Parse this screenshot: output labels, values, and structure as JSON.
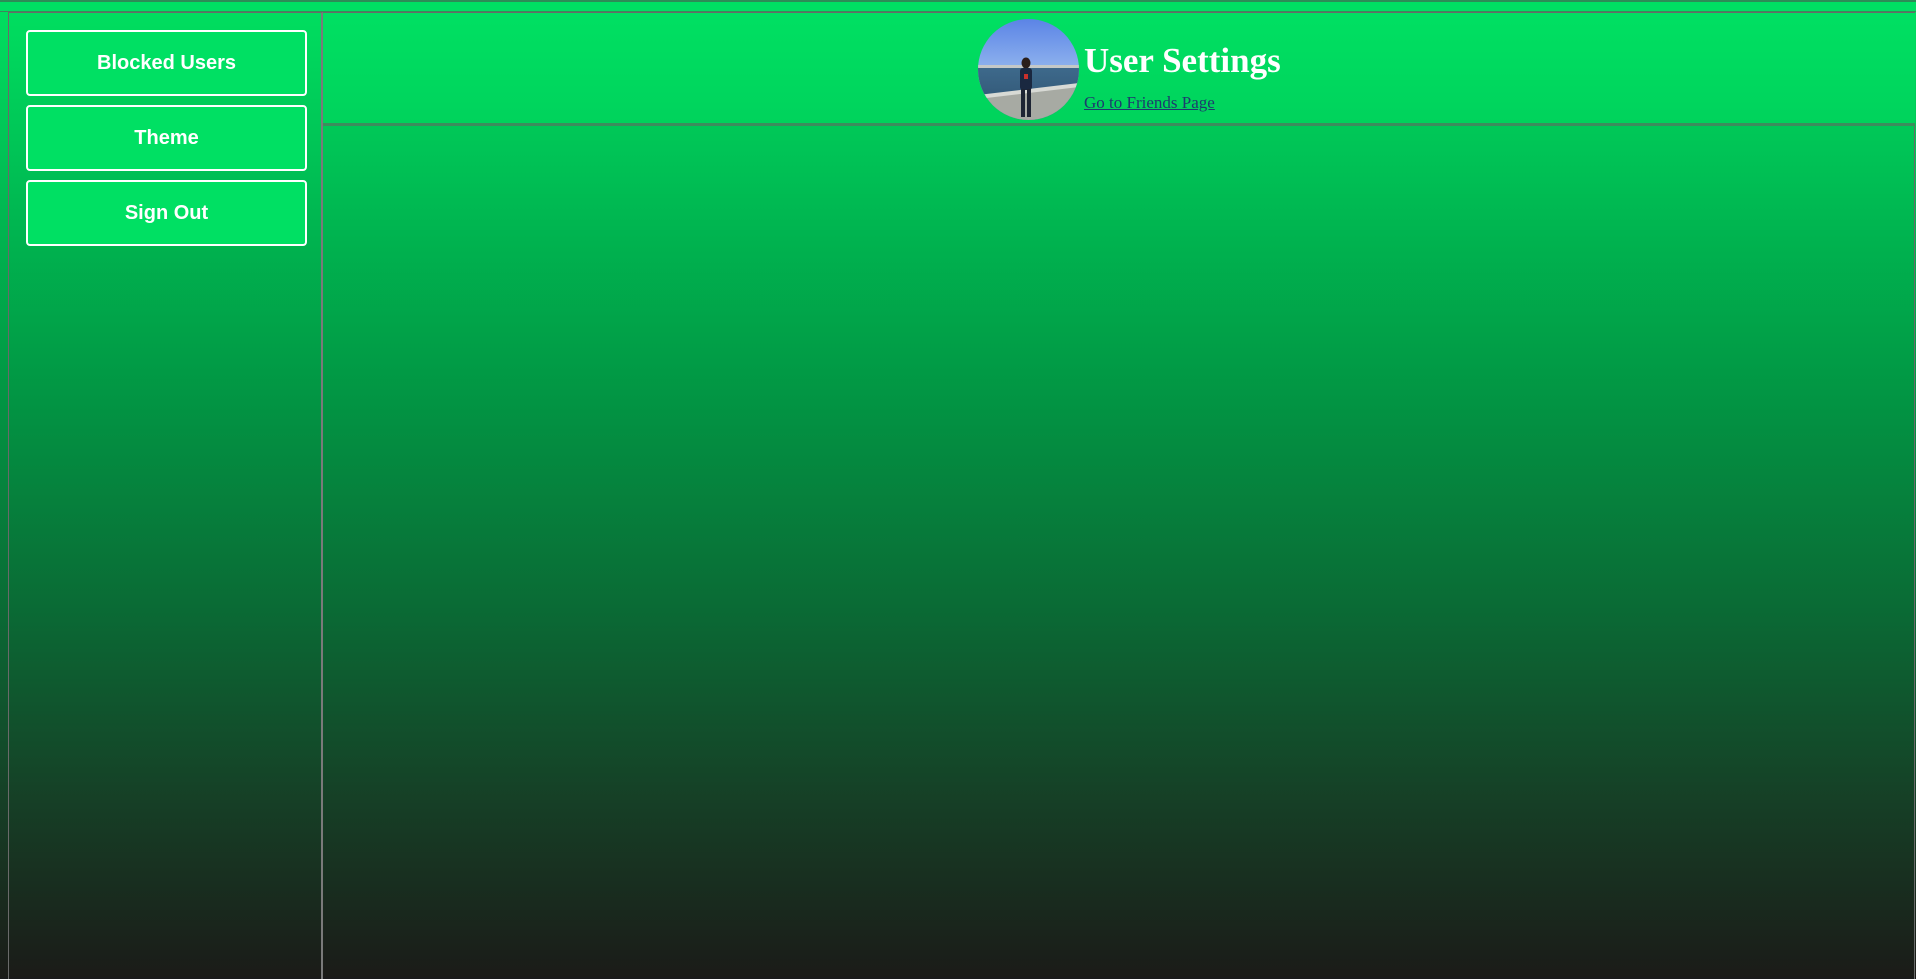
{
  "sidebar": {
    "items": [
      {
        "label": "Blocked Users"
      },
      {
        "label": "Theme"
      },
      {
        "label": "Sign Out"
      }
    ]
  },
  "header": {
    "title": "User Settings",
    "link_text": "Go to Friends Page",
    "avatar_icon": "profile-photo"
  },
  "colors": {
    "accent": "#00e063",
    "link": "#1d3a6e",
    "text": "#ffffff",
    "gradient_top": "#00e060",
    "gradient_bottom": "#1b1b18"
  }
}
